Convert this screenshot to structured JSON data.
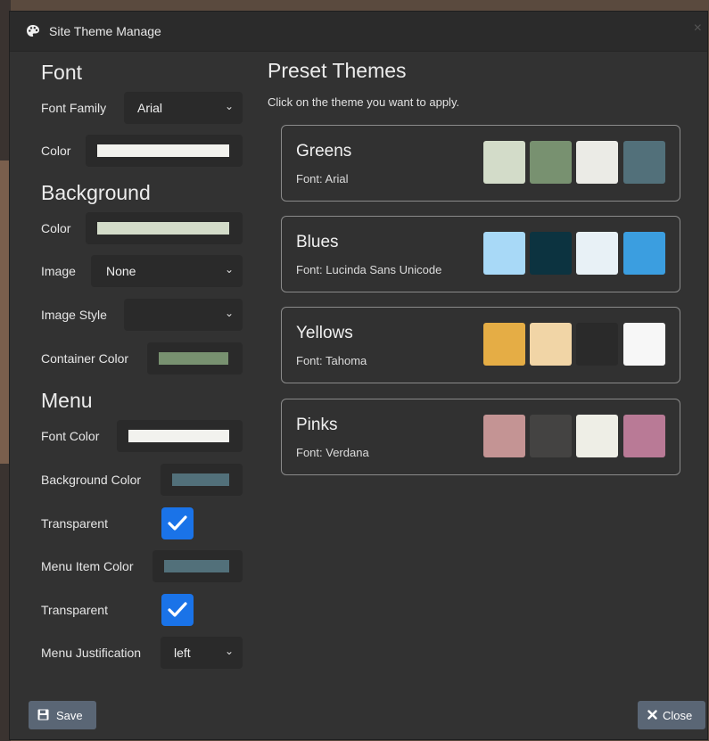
{
  "dialog": {
    "title": "Site Theme Manage",
    "close_glyph": "×"
  },
  "left": {
    "font_section": "Font",
    "font_family_label": "Font Family",
    "font_family_value": "Arial",
    "font_color_label": "Color",
    "font_color": "#f2f2ee",
    "background_section": "Background",
    "bg_color_label": "Color",
    "bg_color": "#d3dcc9",
    "image_label": "Image",
    "image_value": "None",
    "image_style_label": "Image Style",
    "image_style_value": "",
    "container_color_label": "Container Color",
    "container_color": "#789170",
    "menu_section": "Menu",
    "menu_font_color_label": "Font Color",
    "menu_font_color": "#f2f2ee",
    "menu_bg_color_label": "Background Color",
    "menu_bg_color": "#52707a",
    "transparent_label_1": "Transparent",
    "transparent_1_checked": true,
    "menu_item_color_label": "Menu Item Color",
    "menu_item_color": "#52707a",
    "transparent_label_2": "Transparent",
    "transparent_2_checked": true,
    "menu_justification_label": "Menu Justification",
    "menu_justification_value": "left"
  },
  "right": {
    "title": "Preset Themes",
    "subtitle": "Click on the theme you want to apply.",
    "themes": [
      {
        "name": "Greens",
        "font": "Font: Arial",
        "colors": [
          "#d3dcc9",
          "#789170",
          "#ebebe6",
          "#52707a"
        ]
      },
      {
        "name": "Blues",
        "font": "Font: Lucinda Sans Unicode",
        "colors": [
          "#a8d9f7",
          "#0c3340",
          "#e8f1f6",
          "#3b9ee0"
        ]
      },
      {
        "name": "Yellows",
        "font": "Font: Tahoma",
        "colors": [
          "#e5ad45",
          "#f1d5a6",
          "#2a2a2a",
          "#f7f7f7"
        ]
      },
      {
        "name": "Pinks",
        "font": "Font: Verdana",
        "colors": [
          "#c49494",
          "#444342",
          "#eeeee6",
          "#b97a96"
        ]
      }
    ]
  },
  "footer": {
    "save_label": "Save",
    "close_label": "Close"
  },
  "icons": {
    "palette": "palette-icon",
    "chevron": "chevron-down-icon",
    "check": "check-icon",
    "save": "floppy-icon",
    "close": "close-icon"
  }
}
